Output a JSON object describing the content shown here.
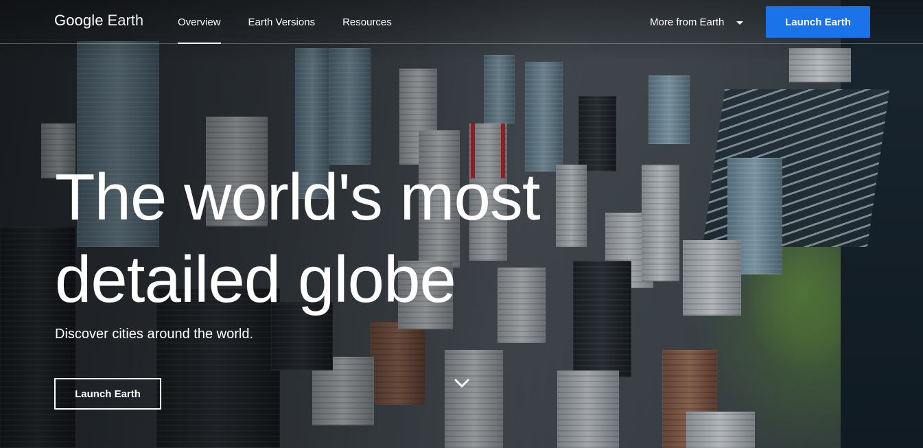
{
  "header": {
    "logo_google": "Google",
    "logo_earth": "Earth",
    "nav": [
      {
        "label": "Overview",
        "active": true
      },
      {
        "label": "Earth Versions",
        "active": false
      },
      {
        "label": "Resources",
        "active": false
      }
    ],
    "more_label": "More from Earth",
    "launch_label": "Launch Earth"
  },
  "hero": {
    "headline_line1": "The world's most",
    "headline_line2": "detailed globe",
    "subtitle": "Discover cities around the world.",
    "cta_label": "Launch Earth"
  },
  "colors": {
    "accent": "#1a73e8",
    "text": "#ffffff"
  },
  "icons": {
    "dropdown": "caret-down-icon",
    "scroll": "chevron-down-icon"
  }
}
